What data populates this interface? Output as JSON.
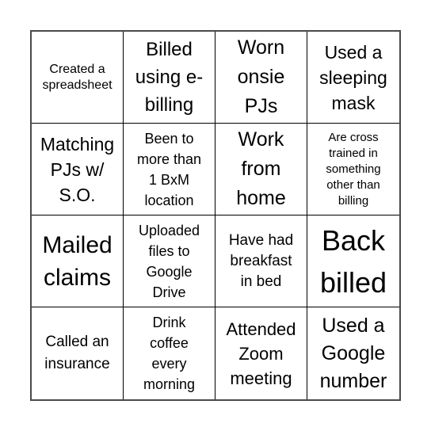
{
  "board": {
    "rows": 4,
    "cols": 4,
    "cells": [
      {
        "text": "Created a spreadsheet",
        "lines": [
          "Created a",
          "spreadsheet"
        ]
      },
      {
        "text": "Billed using e-billing",
        "lines": [
          "Billed",
          "using e-",
          "billing"
        ]
      },
      {
        "text": "Worn onsie PJs",
        "lines": [
          "Worn",
          "onsie",
          "PJs"
        ]
      },
      {
        "text": "Used a sleeping mask",
        "lines": [
          "Used a",
          "sleeping",
          "mask"
        ]
      },
      {
        "text": "Matching PJs w/ S.O.",
        "lines": [
          "Matching",
          "PJs w/",
          "S.O."
        ]
      },
      {
        "text": "Been to more than 1 BxM location",
        "lines": [
          "Been to",
          "more than",
          "1 BxM",
          "location"
        ]
      },
      {
        "text": "Work from home",
        "lines": [
          "Work",
          "from",
          "home"
        ]
      },
      {
        "text": "Are cross trained in something other than billing",
        "lines": [
          "Are cross",
          "trained in",
          "something",
          "other than",
          "billing"
        ]
      },
      {
        "text": "Mailed claims",
        "lines": [
          "Mailed",
          "claims"
        ]
      },
      {
        "text": "Uploaded files to Google Drive",
        "lines": [
          "Uploaded",
          "files to",
          "Google",
          "Drive"
        ]
      },
      {
        "text": "Have had breakfast in bed",
        "lines": [
          "Have had",
          "breakfast",
          "in bed"
        ]
      },
      {
        "text": "Back billed",
        "lines": [
          "Back",
          "billed"
        ]
      },
      {
        "text": "Called an insurance",
        "lines": [
          "Called an",
          "insurance"
        ]
      },
      {
        "text": "Drink coffee every morning",
        "lines": [
          "Drink",
          "coffee",
          "every",
          "morning"
        ]
      },
      {
        "text": "Attended Zoom meeting",
        "lines": [
          "Attended",
          "Zoom",
          "meeting"
        ]
      },
      {
        "text": "Used a Google number",
        "lines": [
          "Used a",
          "Google",
          "number"
        ]
      }
    ]
  }
}
